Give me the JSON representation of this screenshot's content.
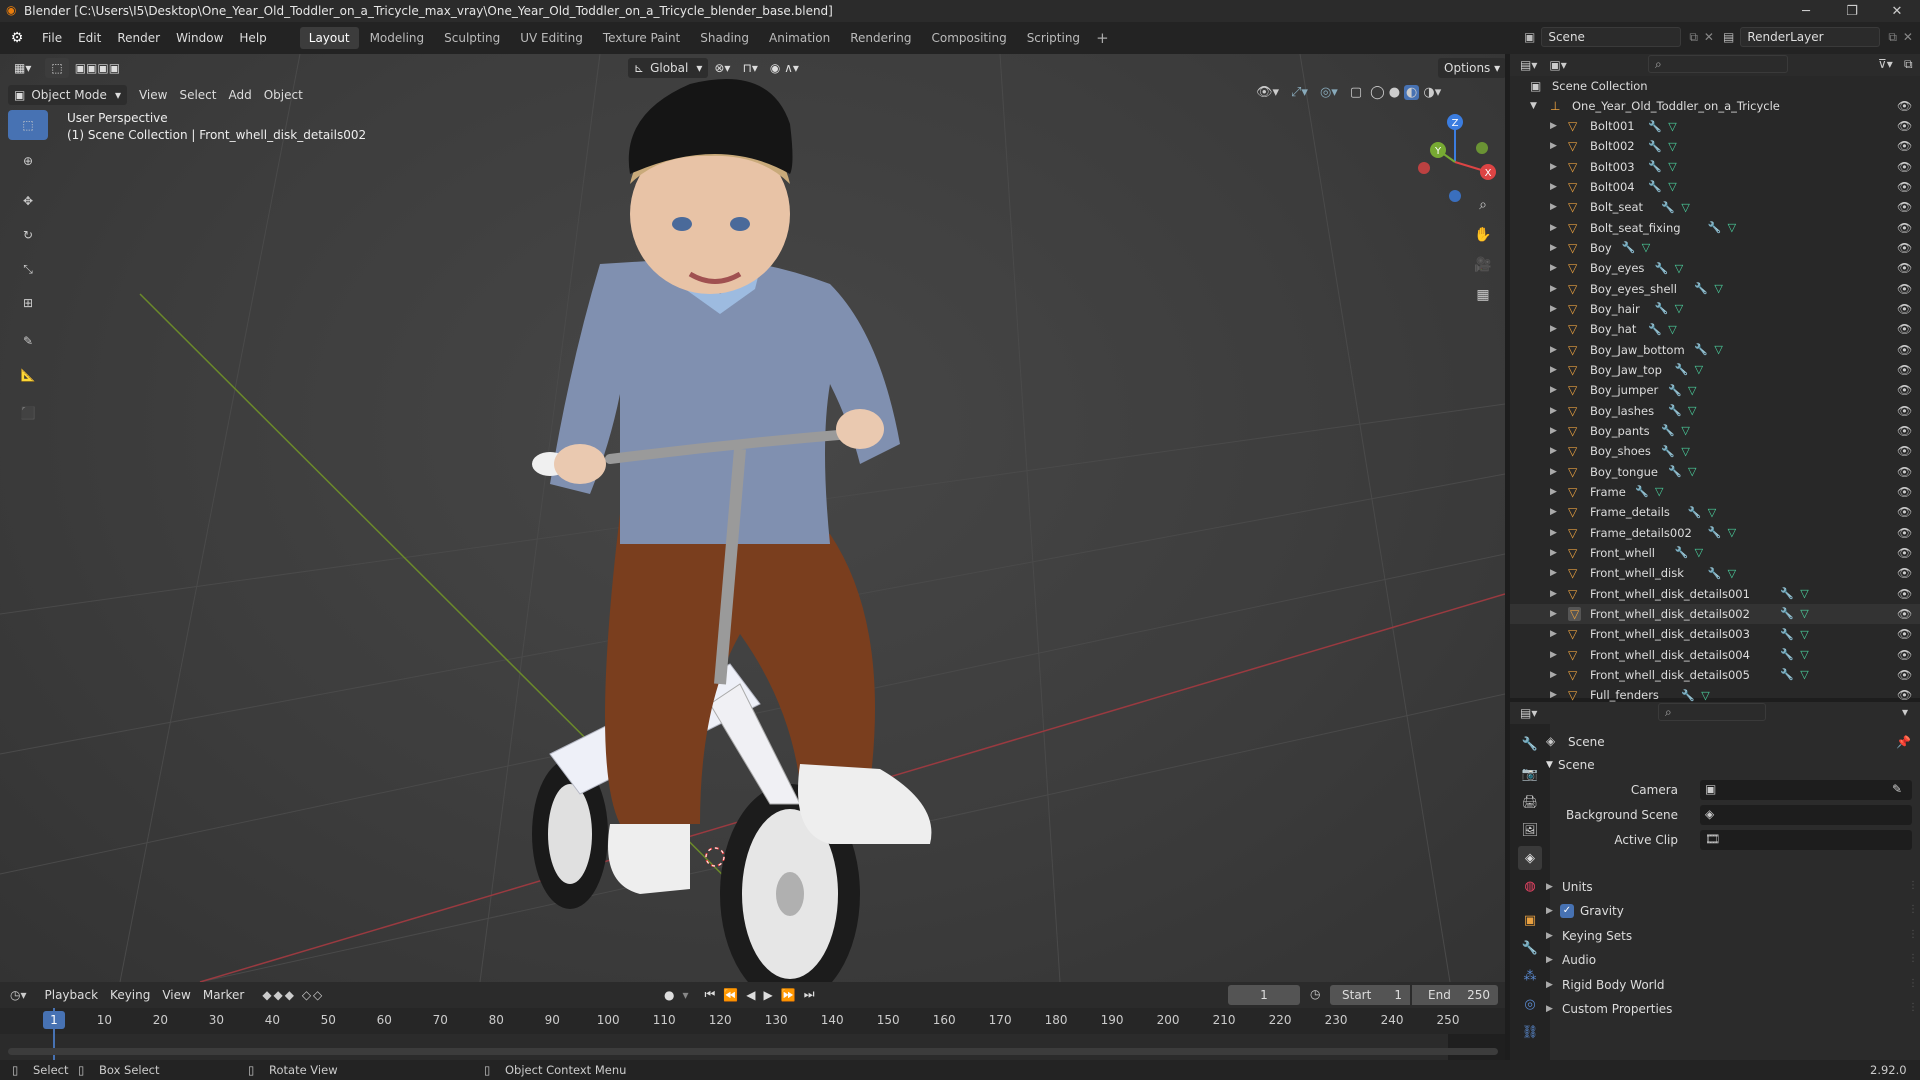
{
  "window": {
    "title": "Blender [C:\\Users\\I5\\Desktop\\One_Year_Old_Toddler_on_a_Tricycle_max_vray\\One_Year_Old_Toddler_on_a_Tricycle_blender_base.blend]"
  },
  "menu": [
    "File",
    "Edit",
    "Render",
    "Window",
    "Help"
  ],
  "workspaces": [
    "Layout",
    "Modeling",
    "Sculpting",
    "UV Editing",
    "Texture Paint",
    "Shading",
    "Animation",
    "Rendering",
    "Compositing",
    "Scripting"
  ],
  "active_workspace": "Layout",
  "scene_field": "Scene",
  "renderlayer_field": "RenderLayer",
  "viewport": {
    "mode": "Object Mode",
    "menus": [
      "View",
      "Select",
      "Add",
      "Object"
    ],
    "transform": "Global",
    "options": "Options",
    "overlay_line1": "User Perspective",
    "overlay_line2": "(1) Scene Collection | Front_whell_disk_details002",
    "axes": {
      "x": "X",
      "y": "Y",
      "z": "Z"
    }
  },
  "outliner": {
    "root": "Scene Collection",
    "collection": "One_Year_Old_Toddler_on_a_Tricycle",
    "items": [
      "Bolt001",
      "Bolt002",
      "Bolt003",
      "Bolt004",
      "Bolt_seat",
      "Bolt_seat_fixing",
      "Boy",
      "Boy_eyes",
      "Boy_eyes_shell",
      "Boy_hair",
      "Boy_hat",
      "Boy_Jaw_bottom",
      "Boy_Jaw_top",
      "Boy_jumper",
      "Boy_lashes",
      "Boy_pants",
      "Boy_shoes",
      "Boy_tongue",
      "Frame",
      "Frame_details",
      "Frame_details002",
      "Front_whell",
      "Front_whell_disk",
      "Front_whell_disk_details001",
      "Front_whell_disk_details002",
      "Front_whell_disk_details003",
      "Front_whell_disk_details004",
      "Front_whell_disk_details005",
      "Full_fenders"
    ],
    "selected": "Front_whell_disk_details002"
  },
  "properties": {
    "header": "Scene",
    "panel": "Scene",
    "camera_label": "Camera",
    "background_label": "Background Scene",
    "clip_label": "Active Clip",
    "sections": [
      "Units",
      "Gravity",
      "Keying Sets",
      "Audio",
      "Rigid Body World",
      "Custom Properties"
    ],
    "gravity_checked": true
  },
  "timeline": {
    "menus": [
      "Playback",
      "Keying",
      "View",
      "Marker"
    ],
    "current_frame": "1",
    "start_label": "Start",
    "start": "1",
    "end_label": "End",
    "end": "250",
    "ruler": [
      1,
      10,
      20,
      30,
      40,
      50,
      60,
      70,
      80,
      90,
      100,
      110,
      120,
      130,
      140,
      150,
      160,
      170,
      180,
      190,
      200,
      210,
      220,
      230,
      240,
      250
    ]
  },
  "status": {
    "select": "Select",
    "box_select": "Box Select",
    "rotate": "Rotate View",
    "context": "Object Context Menu",
    "version": "2.92.0"
  }
}
